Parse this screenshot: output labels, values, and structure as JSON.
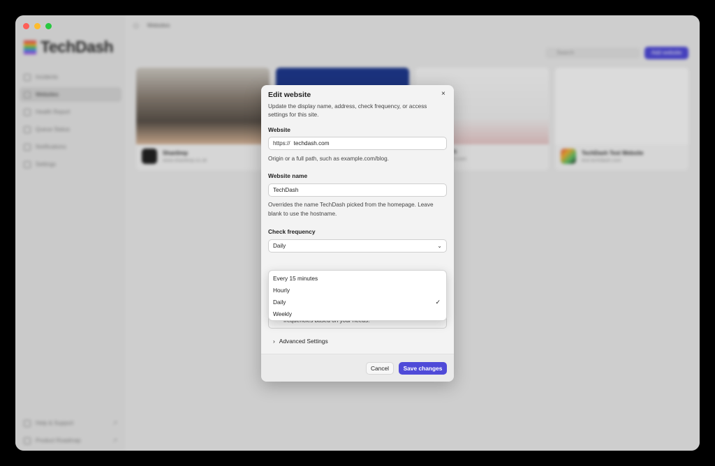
{
  "app": {
    "brand": "TechDash",
    "page_title": "Websites"
  },
  "sidebar": {
    "items": [
      {
        "label": "Incidents"
      },
      {
        "label": "Websites"
      },
      {
        "label": "Health Report"
      },
      {
        "label": "Queue Status"
      },
      {
        "label": "Notifications"
      },
      {
        "label": "Settings"
      }
    ],
    "bottom": [
      {
        "label": "Help & Support"
      },
      {
        "label": "Product Roadmap"
      }
    ]
  },
  "toolbar": {
    "search_placeholder": "Search",
    "add_label": "Add website"
  },
  "cards": [
    {
      "title": "Shanlimp",
      "url": "www.shanlimp.co.uk"
    },
    {
      "title": "",
      "url": ""
    },
    {
      "title": "h",
      "url": "h.com"
    },
    {
      "title": "TechDash Test Website",
      "url": "test.techdash.com"
    }
  ],
  "modal": {
    "title": "Edit website",
    "close_icon": "×",
    "description": "Update the display name, address, check frequency, or access settings for this site.",
    "website": {
      "label": "Website",
      "prefix": "https://",
      "value": "techdash.com",
      "help": "Origin or a full path, such as example.com/blog."
    },
    "name": {
      "label": "Website name",
      "value": "TechDash",
      "help": "Overrides the name TechDash picked from the homepage. Leave blank to use the hostname."
    },
    "frequency": {
      "label": "Check frequency",
      "value": "Daily",
      "options": [
        "Every 15 minutes",
        "Hourly",
        "Daily",
        "Weekly"
      ],
      "selected": "Daily"
    },
    "info_text": "set of URLs which are important to you and set sensible check frequencies based on your needs.",
    "advanced_label": "Advanced Settings",
    "cancel_label": "Cancel",
    "save_label": "Save changes"
  },
  "colors": {
    "accent": "#4f4ad8",
    "window_bg": "#e9e9e9",
    "modal_bg": "#f3f3f3"
  }
}
